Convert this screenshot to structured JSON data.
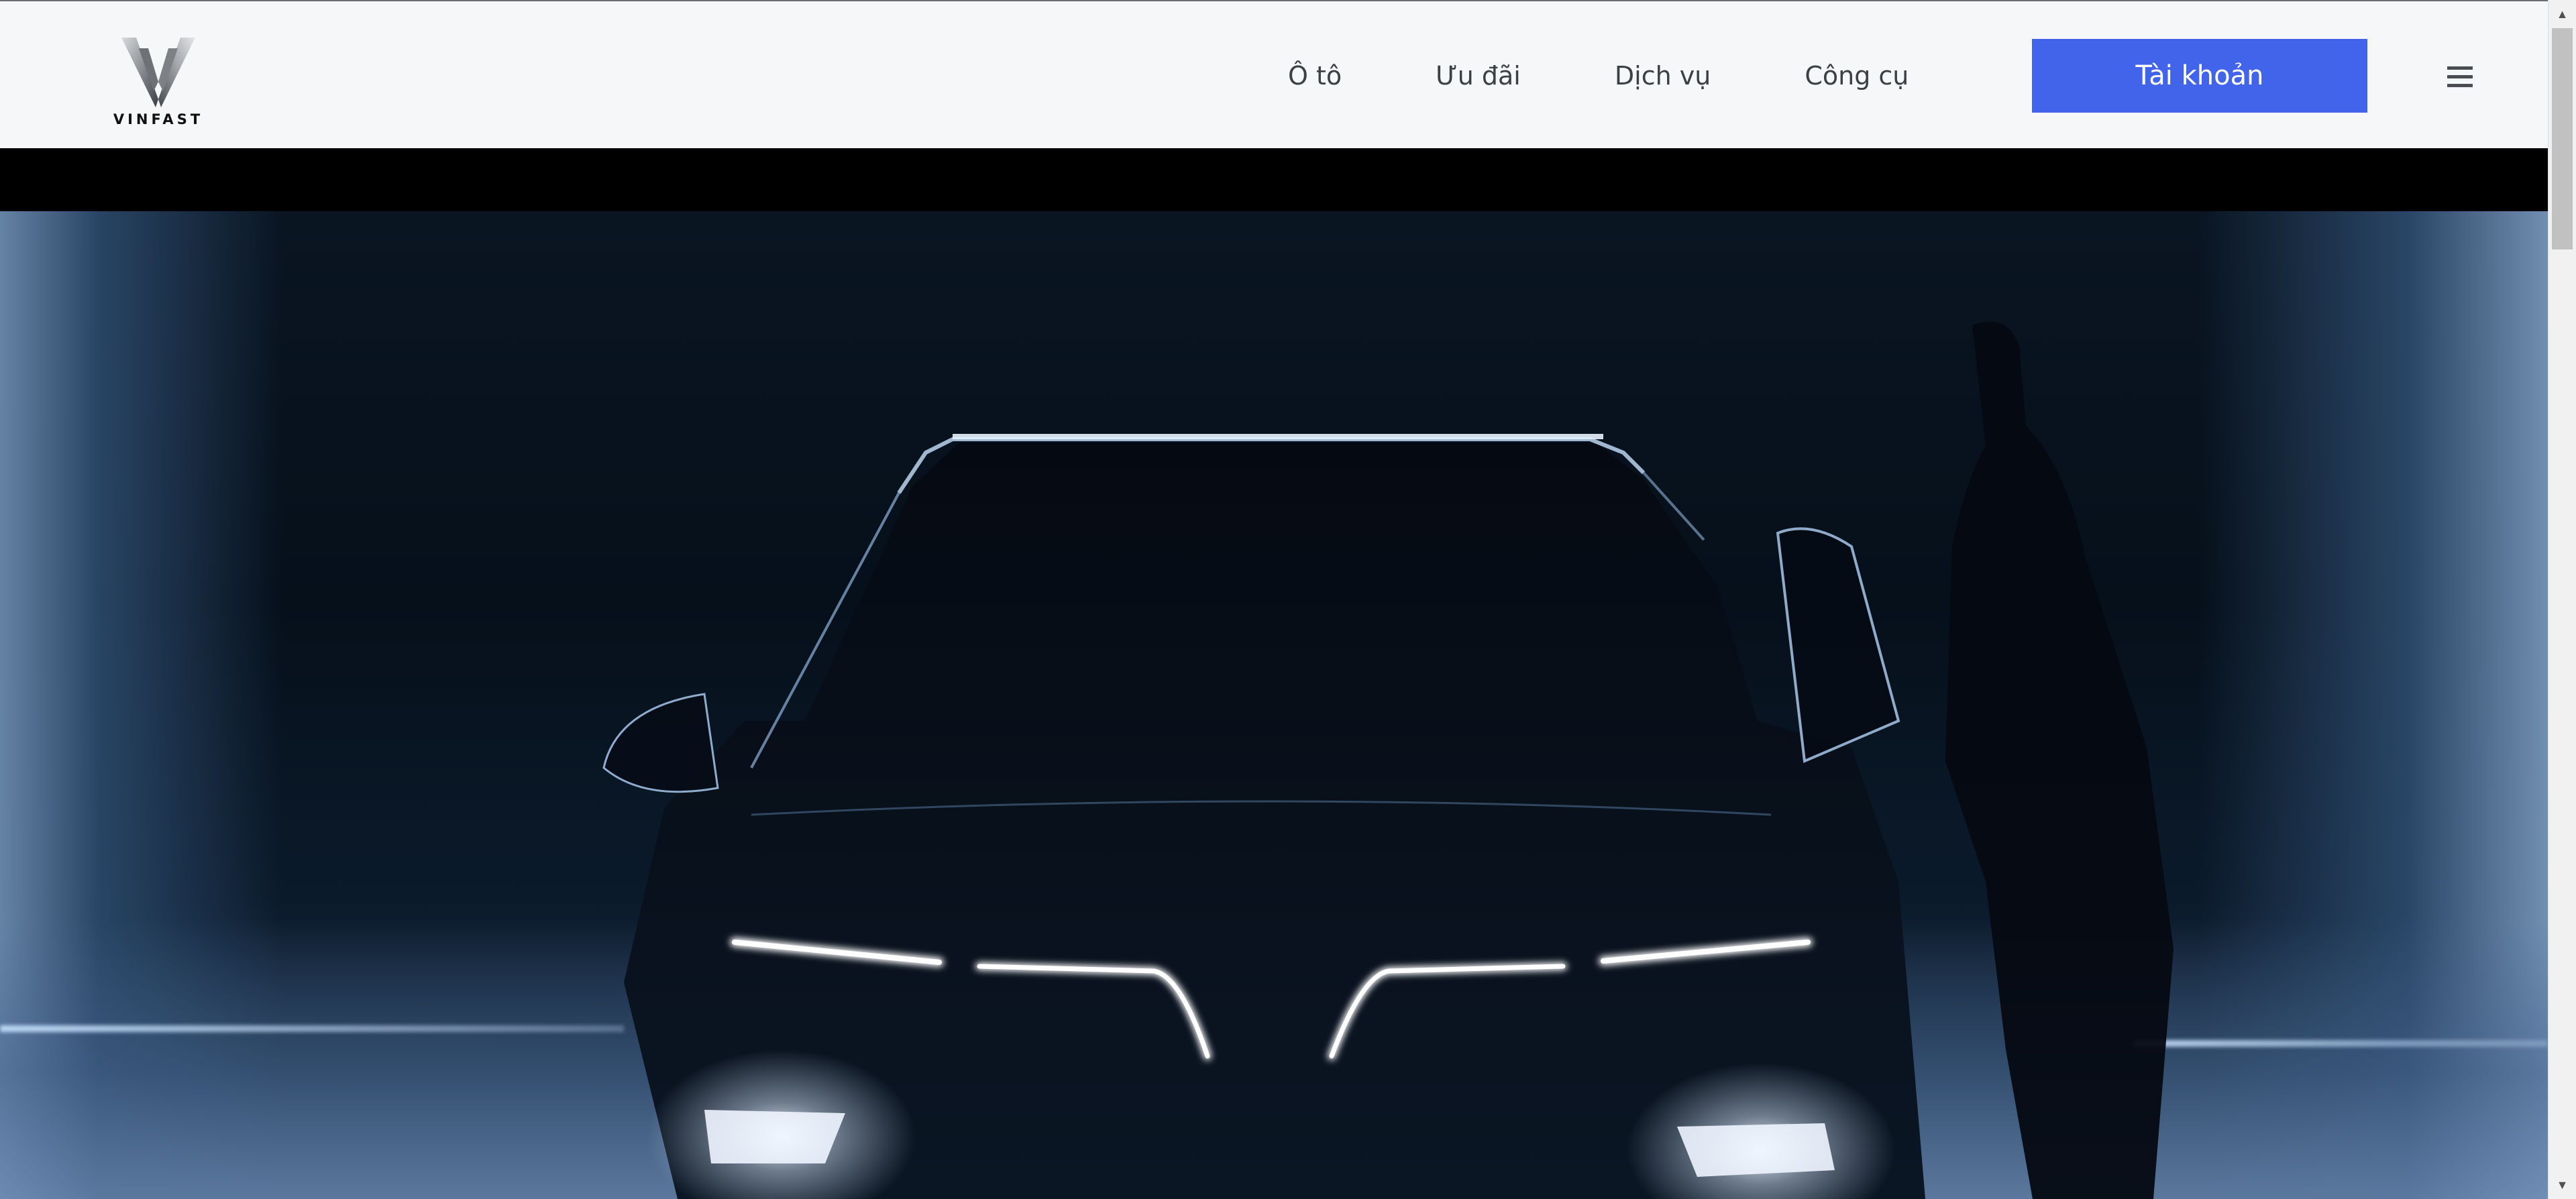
{
  "brand": {
    "logo_text": "VINFAST"
  },
  "nav": {
    "items": [
      {
        "label": "Ô tô"
      },
      {
        "label": "Ưu đãi"
      },
      {
        "label": "Dịch vụ"
      },
      {
        "label": "Công cụ"
      }
    ],
    "account_label": "Tài khoản",
    "menu_icon": "hamburger-menu-icon"
  },
  "hero": {
    "subject": "car-front-silhouette"
  },
  "colors": {
    "header_bg": "#f6f7f9",
    "account_button": "#4264eb",
    "nav_text": "#3c3f44"
  },
  "scrollbar": {
    "up_arrow": "▲",
    "down_arrow": "▼"
  }
}
